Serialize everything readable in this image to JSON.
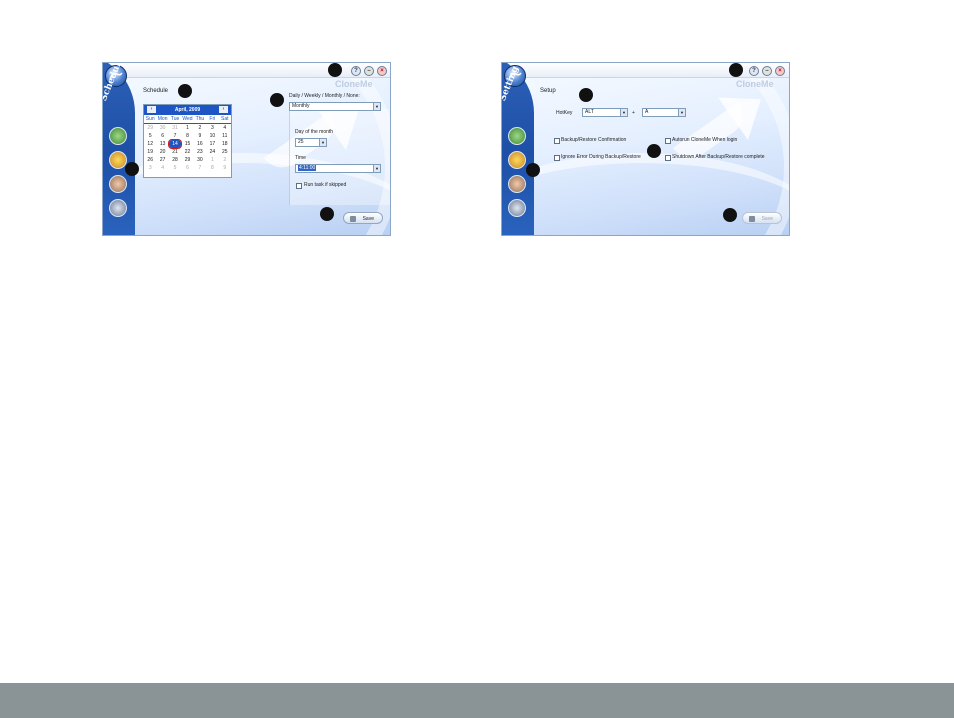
{
  "schedule_window": {
    "sidebar_title": "Schedule",
    "section_label": "Schedule",
    "watermark": "CloneMe",
    "buttons": {
      "help": "?",
      "minimize": "–",
      "close": "×"
    },
    "calendar": {
      "month_label": "April, 2009",
      "prev_label": "‹",
      "next_label": "›",
      "weekdays": [
        "Sun",
        "Mon",
        "Tue",
        "Wed",
        "Thu",
        "Fri",
        "Sat"
      ],
      "weeks": [
        [
          "29",
          "30",
          "31",
          "1",
          "2",
          "3",
          "4"
        ],
        [
          "5",
          "6",
          "7",
          "8",
          "9",
          "10",
          "11"
        ],
        [
          "12",
          "13",
          "14",
          "15",
          "16",
          "17",
          "18"
        ],
        [
          "19",
          "20",
          "21",
          "22",
          "23",
          "24",
          "25"
        ],
        [
          "26",
          "27",
          "28",
          "29",
          "30",
          "1",
          "2"
        ],
        [
          "3",
          "4",
          "5",
          "6",
          "7",
          "8",
          "9"
        ]
      ],
      "selected_day": "14"
    },
    "frequency": {
      "label": "Daily / Weekly / Monthly / None:",
      "value": "Monthly"
    },
    "day_of_month": {
      "label": "Day of the month",
      "value": "25"
    },
    "time": {
      "label": "Time",
      "value": "4:11:00"
    },
    "run_if_skipped": {
      "label": "Run task if skipped",
      "checked": false
    },
    "save_label": "Save",
    "nav_icons": [
      "backup-icon",
      "schedule-icon",
      "restore-icon",
      "settings-icon"
    ]
  },
  "settings_window": {
    "sidebar_title": "Setting",
    "section_label": "Setup",
    "watermark": "CloneMe",
    "buttons": {
      "help": "?",
      "minimize": "–",
      "close": "×"
    },
    "hotkey": {
      "label": "HotKey",
      "modifier": "ALT",
      "plus": "+",
      "key": "A"
    },
    "checkboxes": [
      {
        "label": "Backup/Restore Confirmation",
        "checked": false
      },
      {
        "label": "Autorun CloneMe When login",
        "checked": false
      },
      {
        "label": "Ignore Error During Backup/Restore",
        "checked": false
      },
      {
        "label": "Shutdown After Backup/Restore complete",
        "checked": false
      }
    ],
    "save_label": "Save",
    "nav_icons": [
      "backup-icon",
      "schedule-icon",
      "restore-icon",
      "settings-icon"
    ]
  },
  "colors": {
    "sidebar_blue": "#1d4fa6",
    "calendar_header": "#1d56c4",
    "selection_highlight": "#3165c7",
    "footer_bar": "#8a9496",
    "marker": "#111111"
  }
}
